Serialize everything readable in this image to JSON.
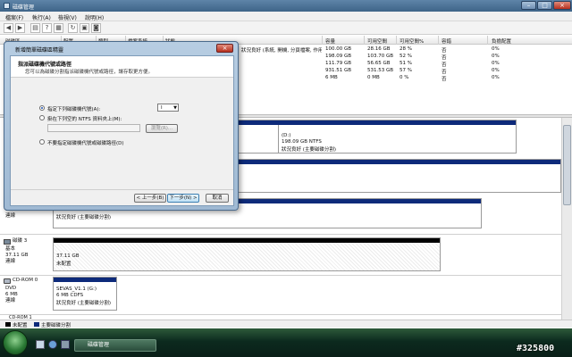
{
  "window": {
    "title": "磁碟管理"
  },
  "menu": [
    "檔案(F)",
    "執行(A)",
    "檢視(V)",
    "說明(H)"
  ],
  "columns": [
    "磁碟區",
    "配置",
    "類型",
    "檔案系統",
    "狀態",
    "容量",
    "可用空間",
    "可用空間%",
    "容錯",
    "負擔配置"
  ],
  "table_rows": [
    {
      "status": "狀況良好 (系統, 開機, 分頁檔案, 作用中, 損毀傾印, 主要磁碟分割)",
      "capacity": "100.00 GB",
      "free": "28.16 GB",
      "pct": "28 %",
      "ft": "否",
      "overhead": "0%"
    },
    {
      "status": "",
      "capacity": "198.09 GB",
      "free": "103.70 GB",
      "pct": "52 %",
      "ft": "否",
      "overhead": "0%"
    },
    {
      "status": "",
      "capacity": "111.79 GB",
      "free": "56.65 GB",
      "pct": "51 %",
      "ft": "否",
      "overhead": "0%"
    },
    {
      "status": "",
      "capacity": "931.51 GB",
      "free": "531.53 GB",
      "pct": "57 %",
      "ft": "否",
      "overhead": "0%"
    },
    {
      "status": "",
      "capacity": "6 MB",
      "free": "0 MB",
      "pct": "0 %",
      "ft": "否",
      "overhead": "0%"
    }
  ],
  "disks": {
    "d_partition": {
      "name": "(D:)",
      "size": "198.09 GB NTFS",
      "status": "狀況良好 (主要磁碟分割)"
    },
    "disk2": {
      "size": "111.79 GB",
      "state": "連線",
      "part_size": "111.79 GB NTFS",
      "part_status": "狀況良好 (主要磁碟分割)"
    },
    "disk3": {
      "name": "磁碟 3",
      "type": "基本",
      "size": "37.11 GB",
      "state": "連線",
      "part_size": "37.11 GB",
      "part_status": "未配置"
    },
    "cdrom0": {
      "name": "CD-ROM 0",
      "type": "DVD",
      "size": "6 MB",
      "state": "連線",
      "vol_name": "SEVAS_V1.1 (G:)",
      "vol_size": "6 MB CDFS",
      "vol_status": "狀況良好 (主要磁碟分割)"
    },
    "cdrom1": {
      "name": "CD-ROM 1"
    }
  },
  "legend": {
    "unallocated": "未配置",
    "primary": "主要磁碟分割",
    "colors": {
      "unallocated": "#000000",
      "primary": "#0d2a7a"
    }
  },
  "dialog": {
    "title": "新增簡單磁碟區精靈",
    "heading": "指派磁碟機代號或路徑",
    "subheading": "您可以為磁碟分割指派磁碟機代號或路徑，讓存取更方便。",
    "option1": "指定下列磁碟機代號(A):",
    "drive_letter": "I",
    "option2": "掛在下列空的 NTFS 資料夾上(M):",
    "browse": "瀏覽(R)...",
    "option3": "不要指定磁碟機代號或磁碟路徑(D)",
    "back": "< 上一步(B)",
    "next": "下一步(N) >",
    "cancel": "取消"
  },
  "taskbar": {
    "task_label": "磁碟管理"
  },
  "watermark": "#325800"
}
